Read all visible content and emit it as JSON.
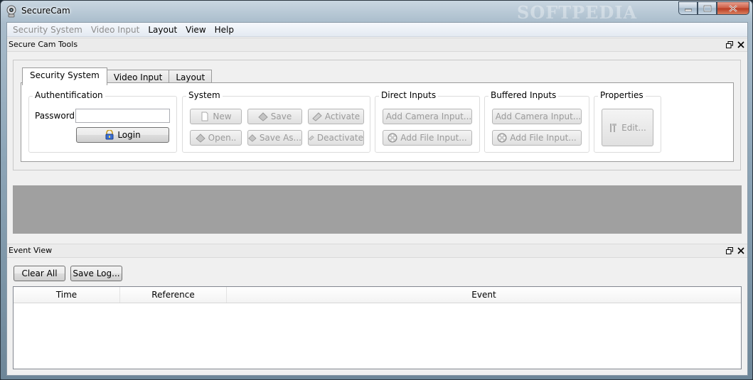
{
  "window": {
    "title": "SecureCam",
    "watermark": "SOFTPEDIA"
  },
  "menubar": {
    "items": [
      {
        "label": "Security System",
        "disabled": true
      },
      {
        "label": "Video Input",
        "disabled": true
      },
      {
        "label": "Layout",
        "disabled": false
      },
      {
        "label": "View",
        "disabled": false
      },
      {
        "label": "Help",
        "disabled": false
      }
    ]
  },
  "tools_dock": {
    "title": "Secure Cam Tools",
    "tabs": [
      "Security System",
      "Video Input",
      "Layout"
    ],
    "active_tab": "Security System",
    "groups": {
      "authentication": {
        "title": "Authentification",
        "password_label": "Password:",
        "password_value": "",
        "login_label": "Login"
      },
      "system": {
        "title": "System",
        "new_label": "New",
        "save_label": "Save",
        "activate_label": "Activate",
        "open_label": "Open..",
        "save_as_label": "Save As...",
        "deactivate_label": "Deactivate"
      },
      "direct_inputs": {
        "title": "Direct Inputs",
        "add_camera_label": "Add Camera Input...",
        "add_file_label": "Add File Input..."
      },
      "buffered_inputs": {
        "title": "Buffered Inputs",
        "add_camera_label": "Add Camera Input...",
        "add_file_label": "Add File Input..."
      },
      "properties": {
        "title": "Properties",
        "edit_label": "Edit..."
      }
    }
  },
  "event_dock": {
    "title": "Event View",
    "clear_label": "Clear All",
    "save_log_label": "Save Log...",
    "columns": [
      "Time",
      "Reference",
      "Event"
    ],
    "rows": []
  }
}
